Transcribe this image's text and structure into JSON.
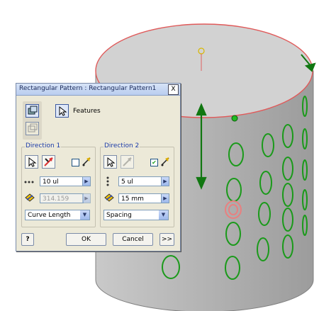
{
  "dialog": {
    "title": "Rectangular Pattern : Rectangular Pattern1",
    "close_label": "X",
    "features_label": "Features",
    "direction1": {
      "title": "Direction 1",
      "count": "10 ul",
      "length": "314.159 mm",
      "method": "Curve Length",
      "flip_checked": false
    },
    "direction2": {
      "title": "Direction 2",
      "count": "5 ul",
      "length": "15 mm",
      "method": "Spacing",
      "flip_checked": true
    },
    "help_label": "?",
    "ok_label": "OK",
    "cancel_label": "Cancel",
    "more_label": ">>"
  },
  "icons": {
    "pattern_solids": "pattern-solids-icon",
    "pattern_faces": "pattern-faces-icon",
    "select": "cursor-arrow-icon",
    "flip": "flip-direction-icon",
    "midplane": "midplane-icon",
    "count": "count-dots-icon",
    "length": "length-icon",
    "dropdown": "chevron-down-icon",
    "arrow": "chevron-right-icon"
  },
  "colors": {
    "cylinder_top": "#d0d0d0",
    "cylinder_side": "#b8b8b8",
    "edge_highlight": "#e06060",
    "pattern_green": "#1a9a1a",
    "dialog_bg": "#ece9d8"
  }
}
